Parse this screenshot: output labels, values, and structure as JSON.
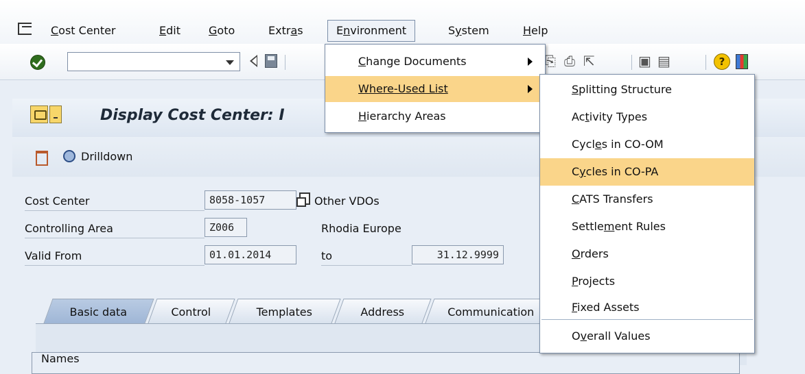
{
  "menubar": {
    "items": [
      {
        "label": "Cost Center",
        "mnemonic": "C",
        "rest": "ost Center"
      },
      {
        "label": "Edit",
        "mnemonic": "E",
        "rest": "dit"
      },
      {
        "label": "Goto",
        "mnemonic": "G",
        "rest": "oto"
      },
      {
        "label": "Extras",
        "pre": "Extr",
        "mnemonic": "a",
        "rest": "s"
      },
      {
        "label": "Environment",
        "pre": "E",
        "mnemonic": "n",
        "rest": "vironment"
      },
      {
        "label": "System",
        "pre": "S",
        "mnemonic": "y",
        "rest": "stem"
      },
      {
        "label": "Help",
        "mnemonic": "H",
        "rest": "elp"
      }
    ]
  },
  "title": {
    "text": "Display Cost Center: I"
  },
  "app_toolbar": {
    "drilldown_label": "Drilldown"
  },
  "form": {
    "cost_center": {
      "label": "Cost Center",
      "value": "8058-1057",
      "description": "Other VDOs"
    },
    "controlling_area": {
      "label": "Controlling Area",
      "value": "Z006",
      "description": "Rhodia Europe"
    },
    "valid_from": {
      "label": "Valid From",
      "value": "01.01.2014",
      "to_label": "to",
      "to_value": "31.12.9999"
    }
  },
  "tabs": [
    {
      "label": "Basic data",
      "active": true
    },
    {
      "label": "Control",
      "active": false
    },
    {
      "label": "Templates",
      "active": false
    },
    {
      "label": "Address",
      "active": false
    },
    {
      "label": "Communication",
      "active": false
    }
  ],
  "names_group_label": "Names",
  "environment_menu": {
    "items": [
      {
        "label": "Change Documents",
        "mnemonic": "C",
        "rest": "hange Documents",
        "has_submenu": true
      },
      {
        "label": "Where-Used List",
        "mnemonic": "W",
        "rest": "here-Used List",
        "has_submenu": true,
        "highlighted": true
      },
      {
        "label": "Hierarchy Areas",
        "mnemonic": "H",
        "rest": "ierarchy Areas",
        "has_submenu": false
      }
    ]
  },
  "where_used_submenu": {
    "items": [
      {
        "label": "Splitting Structure",
        "pre": "",
        "mnemonic": "S",
        "rest": "plitting Structure"
      },
      {
        "label": "Activity Types",
        "pre": "Ac",
        "mnemonic": "t",
        "rest": "ivity Types"
      },
      {
        "label": "Cycles in CO-OM",
        "pre": "Cycl",
        "mnemonic": "e",
        "rest": "s in CO-OM"
      },
      {
        "label": "Cycles in CO-PA",
        "pre": "C",
        "mnemonic": "y",
        "rest": "cles in CO-PA",
        "highlighted": true
      },
      {
        "label": "CATS Transfers",
        "pre": "",
        "mnemonic": "C",
        "rest": "ATS Transfers"
      },
      {
        "label": "Settlement Rules",
        "pre": "Settle",
        "mnemonic": "m",
        "rest": "ent Rules"
      },
      {
        "label": "Orders",
        "pre": "",
        "mnemonic": "O",
        "rest": "rders"
      },
      {
        "label": "Projects",
        "pre": "",
        "mnemonic": "P",
        "rest": "rojects"
      },
      {
        "label": "Fixed Assets",
        "pre": "",
        "mnemonic": "F",
        "rest": "ixed Assets"
      },
      {
        "label": "Overall Values",
        "pre": "O",
        "mnemonic": "v",
        "rest": "erall Values"
      }
    ]
  },
  "colors": {
    "highlight": "#fad58a",
    "title_text": "#1e2a38"
  }
}
